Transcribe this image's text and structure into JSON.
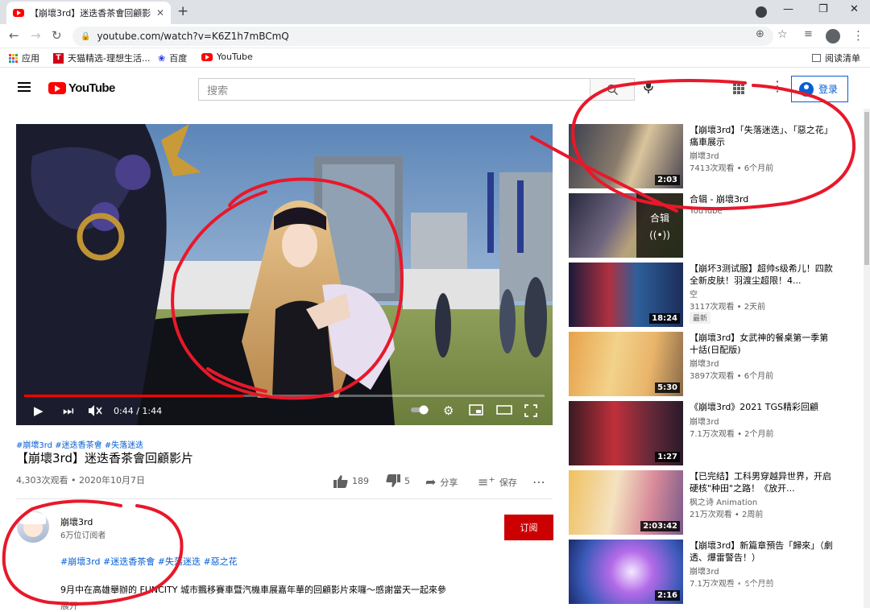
{
  "browser": {
    "tab_title": "【崩壞3rd】迷迭香茶會回顧影片",
    "url": "youtube.com/watch?v=K6Z1h7mBCmQ",
    "bookmarks": [
      {
        "label": "应用"
      },
      {
        "label": "天猫精选-理想生活..."
      },
      {
        "label": "百度"
      },
      {
        "label": "YouTube"
      }
    ],
    "reading_list": "阅读清单"
  },
  "header": {
    "logo_text": "YouTube",
    "search_placeholder": "搜索",
    "sign_in": "登录"
  },
  "player": {
    "time": "0:44 / 1:44",
    "progress": 0.423
  },
  "video": {
    "hashtags": "#崩壞3rd #迷迭香茶會 #失落迷迭",
    "title": "【崩壞3rd】迷迭香茶會回顧影片",
    "meta": "4,303次观看 • 2020年10月7日",
    "likes": "189",
    "dislikes": "5",
    "share": "分享",
    "save": "保存"
  },
  "channel": {
    "name": "崩壞3rd",
    "subscribers": "6万位订阅者",
    "subscribe": "订阅",
    "hashtags": "#崩壞3rd #迷迭香茶會 #失落迷迭 #惡之花",
    "description": "9月中在高雄舉辦的 FUNCITY 城市飄移賽車暨汽機車展嘉年華的回顧影片來囉～感謝當天一起來參",
    "show_more": "展开"
  },
  "recommendations": [
    {
      "title": "【崩壞3rd】「失落迷迭」、「惡之花」痛車展示",
      "channel": "崩壞3rd",
      "views": "7413次观看 • 6个月前",
      "duration": "2:03"
    },
    {
      "title": "合辑 - 崩壞3rd",
      "channel": "YouTube",
      "views": "",
      "mix_label": "合辑"
    },
    {
      "title": "【崩坏3测试服】超帅s级希儿！四款全新皮肤！羽渡尘超限！4...",
      "channel": "空",
      "views": "3117次观看 • 2天前",
      "badge": "最新",
      "duration": "18:24"
    },
    {
      "title": "【崩壞3rd】女武神的餐桌第一季第十話(日配版)",
      "channel": "崩壞3rd",
      "views": "3897次观看 • 6个月前",
      "duration": "5:30"
    },
    {
      "title": "《崩壞3rd》2021 TGS精彩回顧",
      "channel": "崩壞3rd",
      "views": "7.1万次观看 • 2个月前",
      "duration": "1:27"
    },
    {
      "title": "【已完结】工科男穿越异世界，开启硬核\"种田\"之路！《放开...",
      "channel": "枫之诗 Animation",
      "views": "21万次观看 • 2周前",
      "duration": "2:03:42"
    },
    {
      "title": "【崩壞3rd】新篇章預告「歸來」（劇透、爆雷警告！）",
      "channel": "崩壞3rd",
      "views": "7.1万次观看 • 6个月前",
      "duration": "2:16"
    }
  ],
  "colors": {
    "brand_red": "#ff0000",
    "subscribe_red": "#cc0000",
    "link_blue": "#065fd4",
    "annotation_red": "#e8182a"
  }
}
